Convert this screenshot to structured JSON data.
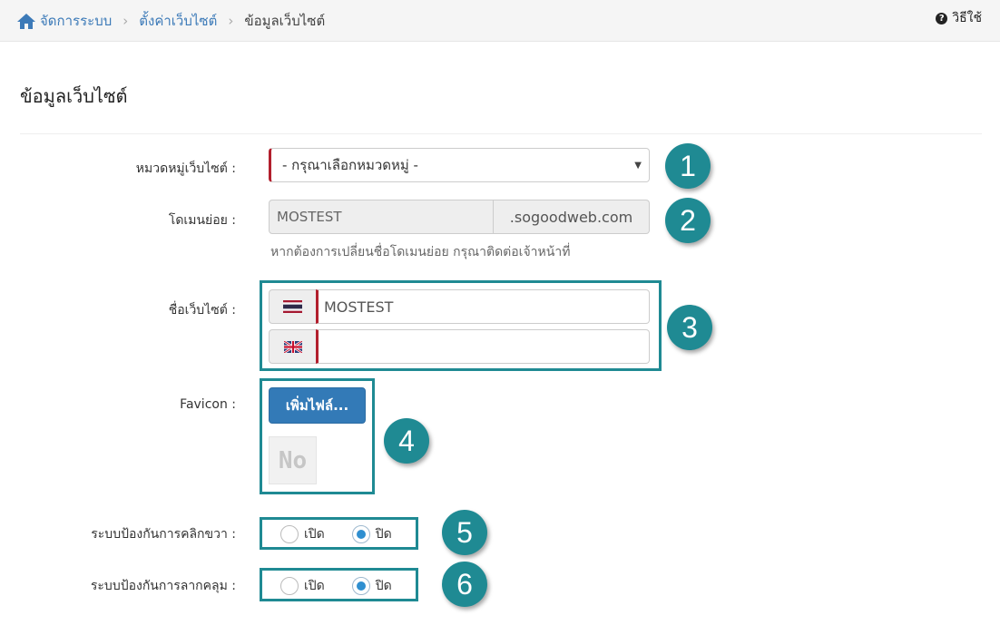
{
  "breadcrumb": {
    "home_icon": "home-icon",
    "items": [
      "จัดการระบบ",
      "ตั้งค่าเว็บไซต์"
    ],
    "current": "ข้อมูลเว็บไซต์"
  },
  "help": {
    "icon": "question-circle-icon",
    "label": "วิธีใช้"
  },
  "page_title": "ข้อมูลเว็บไซต์",
  "form": {
    "category": {
      "label": "หมวดหมู่เว็บไซต์ :",
      "selected": "- กรุณาเลือกหมวดหมู่ -"
    },
    "subdomain": {
      "label": "โดเมนย่อย :",
      "value": "MOSTEST",
      "suffix": ".sogoodweb.com",
      "help": "หากต้องการเปลี่ยนชื่อโดเมนย่อย กรุณาติดต่อเจ้าหน้าที่"
    },
    "site_name": {
      "label": "ชื่อเว็บไซต์ :",
      "thai_value": "MOSTEST",
      "english_value": "",
      "thai_flag_icon": "thailand-flag-icon",
      "english_flag_icon": "uk-flag-icon"
    },
    "favicon": {
      "label": "Favicon :",
      "button": "เพิ่มไฟล์...",
      "preview_text": "No"
    },
    "right_click_protection": {
      "label": "ระบบป้องกันการคลิกขวา :",
      "options": [
        "เปิด",
        "ปิด"
      ],
      "selected": "ปิด"
    },
    "drag_protection": {
      "label": "ระบบป้องกันการลากคลุม :",
      "options": [
        "เปิด",
        "ปิด"
      ],
      "selected": "ปิด"
    }
  },
  "callouts": [
    "1",
    "2",
    "3",
    "4",
    "5",
    "6"
  ],
  "colors": {
    "accent": "#337ab7",
    "callout": "#1f8a93",
    "required": "#b21f2d",
    "link": "#3c7ab8"
  }
}
